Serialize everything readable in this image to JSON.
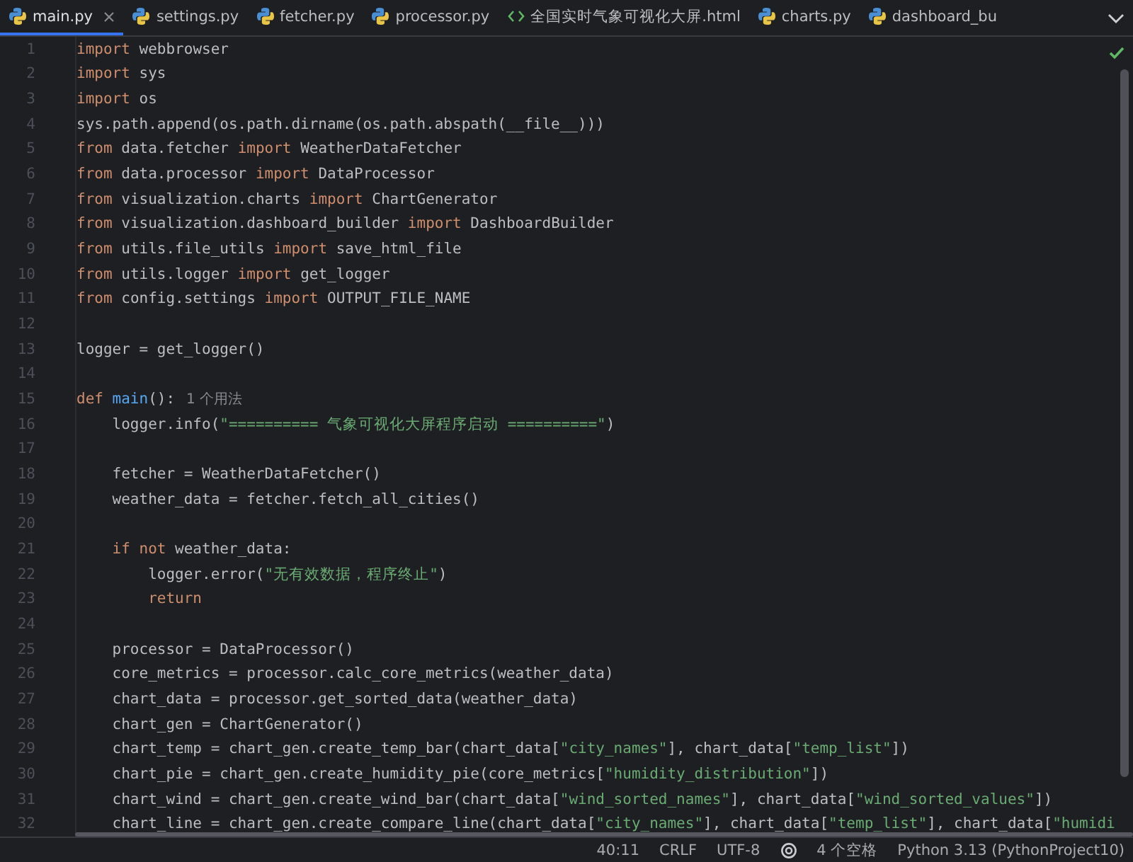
{
  "tabs": [
    {
      "label": "main.py",
      "kind": "python",
      "selected": true,
      "closable": true
    },
    {
      "label": "settings.py",
      "kind": "python",
      "selected": false
    },
    {
      "label": "fetcher.py",
      "kind": "python",
      "selected": false
    },
    {
      "label": "processor.py",
      "kind": "python",
      "selected": false
    },
    {
      "label": "全国实时气象可视化大屏.html",
      "kind": "html",
      "selected": false
    },
    {
      "label": "charts.py",
      "kind": "python",
      "selected": false
    },
    {
      "label": "dashboard_bu",
      "kind": "python",
      "selected": false
    }
  ],
  "editor": {
    "lines": [
      {
        "number": "1",
        "tokens": [
          {
            "kind": "keyword",
            "text": "import"
          },
          {
            "kind": "plain",
            "text": " webbrowser"
          }
        ]
      },
      {
        "number": "2",
        "tokens": [
          {
            "kind": "keyword",
            "text": "import"
          },
          {
            "kind": "plain",
            "text": " sys"
          }
        ]
      },
      {
        "number": "3",
        "tokens": [
          {
            "kind": "keyword",
            "text": "import"
          },
          {
            "kind": "plain",
            "text": " os"
          }
        ]
      },
      {
        "number": "4",
        "tokens": [
          {
            "kind": "plain",
            "text": "sys.path.append(os.path.dirname(os.path.abspath(__file__)))"
          }
        ]
      },
      {
        "number": "5",
        "tokens": [
          {
            "kind": "keyword",
            "text": "from"
          },
          {
            "kind": "plain",
            "text": " data.fetcher "
          },
          {
            "kind": "keyword",
            "text": "import"
          },
          {
            "kind": "plain",
            "text": " WeatherDataFetcher"
          }
        ]
      },
      {
        "number": "6",
        "tokens": [
          {
            "kind": "keyword",
            "text": "from"
          },
          {
            "kind": "plain",
            "text": " data.processor "
          },
          {
            "kind": "keyword",
            "text": "import"
          },
          {
            "kind": "plain",
            "text": " DataProcessor"
          }
        ]
      },
      {
        "number": "7",
        "tokens": [
          {
            "kind": "keyword",
            "text": "from"
          },
          {
            "kind": "plain",
            "text": " visualization.charts "
          },
          {
            "kind": "keyword",
            "text": "import"
          },
          {
            "kind": "plain",
            "text": " ChartGenerator"
          }
        ]
      },
      {
        "number": "8",
        "tokens": [
          {
            "kind": "keyword",
            "text": "from"
          },
          {
            "kind": "plain",
            "text": " visualization.dashboard_builder "
          },
          {
            "kind": "keyword",
            "text": "import"
          },
          {
            "kind": "plain",
            "text": " DashboardBuilder"
          }
        ]
      },
      {
        "number": "9",
        "tokens": [
          {
            "kind": "keyword",
            "text": "from"
          },
          {
            "kind": "plain",
            "text": " utils.file_utils "
          },
          {
            "kind": "keyword",
            "text": "import"
          },
          {
            "kind": "plain",
            "text": " save_html_file"
          }
        ]
      },
      {
        "number": "10",
        "tokens": [
          {
            "kind": "keyword",
            "text": "from"
          },
          {
            "kind": "plain",
            "text": " utils.logger "
          },
          {
            "kind": "keyword",
            "text": "import"
          },
          {
            "kind": "plain",
            "text": " get_logger"
          }
        ]
      },
      {
        "number": "11",
        "tokens": [
          {
            "kind": "keyword",
            "text": "from"
          },
          {
            "kind": "plain",
            "text": " config.settings "
          },
          {
            "kind": "keyword",
            "text": "import"
          },
          {
            "kind": "plain",
            "text": " OUTPUT_FILE_NAME"
          }
        ]
      },
      {
        "number": "12"
      },
      {
        "number": "13",
        "tokens": [
          {
            "kind": "plain",
            "text": "logger = get_logger()"
          }
        ]
      },
      {
        "number": "14"
      },
      {
        "number": "15",
        "tokens": [
          {
            "kind": "keyword",
            "text": "def"
          },
          {
            "kind": "function",
            "text": " main"
          },
          {
            "kind": "plain",
            "text": "():"
          }
        ],
        "hint": "1 个用法"
      },
      {
        "number": "16",
        "tokens": [
          {
            "kind": "plain",
            "text": "    logger.info("
          },
          {
            "kind": "string",
            "text": "\"========== 气象可视化大屏程序启动 ==========\""
          },
          {
            "kind": "plain",
            "text": ")"
          }
        ]
      },
      {
        "number": "17"
      },
      {
        "number": "18",
        "tokens": [
          {
            "kind": "plain",
            "text": "    fetcher = WeatherDataFetcher()"
          }
        ]
      },
      {
        "number": "19",
        "tokens": [
          {
            "kind": "plain",
            "text": "    weather_data = fetcher.fetch_all_cities()"
          }
        ]
      },
      {
        "number": "20"
      },
      {
        "number": "21",
        "tokens": [
          {
            "kind": "keyword",
            "text": "    if not"
          },
          {
            "kind": "plain",
            "text": " weather_data:"
          }
        ]
      },
      {
        "number": "22",
        "tokens": [
          {
            "kind": "plain",
            "text": "        logger.error("
          },
          {
            "kind": "string",
            "text": "\"无有效数据，程序终止\""
          },
          {
            "kind": "plain",
            "text": ")"
          }
        ]
      },
      {
        "number": "23",
        "tokens": [
          {
            "kind": "keyword",
            "text": "        return"
          }
        ]
      },
      {
        "number": "24"
      },
      {
        "number": "25",
        "tokens": [
          {
            "kind": "plain",
            "text": "    processor = DataProcessor()"
          }
        ]
      },
      {
        "number": "26",
        "tokens": [
          {
            "kind": "plain",
            "text": "    core_metrics = processor.calc_core_metrics(weather_data)"
          }
        ]
      },
      {
        "number": "27",
        "tokens": [
          {
            "kind": "plain",
            "text": "    chart_data = processor.get_sorted_data(weather_data)"
          }
        ]
      },
      {
        "number": "28",
        "tokens": [
          {
            "kind": "plain",
            "text": "    chart_gen = ChartGenerator()"
          }
        ]
      },
      {
        "number": "29",
        "tokens": [
          {
            "kind": "plain",
            "text": "    chart_temp = chart_gen.create_temp_bar(chart_data["
          },
          {
            "kind": "string",
            "text": "\"city_names\""
          },
          {
            "kind": "plain",
            "text": "], chart_data["
          },
          {
            "kind": "string",
            "text": "\"temp_list\""
          },
          {
            "kind": "plain",
            "text": "])"
          }
        ]
      },
      {
        "number": "30",
        "tokens": [
          {
            "kind": "plain",
            "text": "    chart_pie = chart_gen.create_humidity_pie(core_metrics["
          },
          {
            "kind": "string",
            "text": "\"humidity_distribution\""
          },
          {
            "kind": "plain",
            "text": "])"
          }
        ]
      },
      {
        "number": "31",
        "tokens": [
          {
            "kind": "plain",
            "text": "    chart_wind = chart_gen.create_wind_bar(chart_data["
          },
          {
            "kind": "string",
            "text": "\"wind_sorted_names\""
          },
          {
            "kind": "plain",
            "text": "], chart_data["
          },
          {
            "kind": "string",
            "text": "\"wind_sorted_values\""
          },
          {
            "kind": "plain",
            "text": "])"
          }
        ]
      },
      {
        "number": "32",
        "tokens": [
          {
            "kind": "plain",
            "text": "    chart_line = chart_gen.create_compare_line(chart_data["
          },
          {
            "kind": "string",
            "text": "\"city_names\""
          },
          {
            "kind": "plain",
            "text": "], chart_data["
          },
          {
            "kind": "string",
            "text": "\"temp_list\""
          },
          {
            "kind": "plain",
            "text": "], chart_data["
          },
          {
            "kind": "string",
            "text": "\"humidi"
          }
        ]
      }
    ]
  },
  "status_bar": {
    "position": "40:11",
    "line_ending": "CRLF",
    "encoding": "UTF-8",
    "indent": "4 个空格",
    "interpreter": "Python 3.13 (PythonProject10)"
  }
}
